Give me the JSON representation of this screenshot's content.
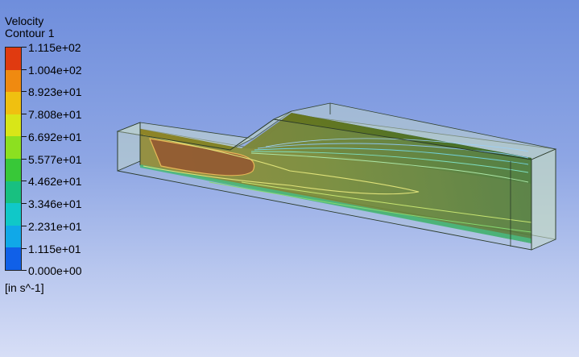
{
  "legend": {
    "title": "Velocity",
    "subtitle": "Contour 1",
    "units": "[in s^-1]",
    "levels": [
      {
        "label": "1.115e+02",
        "color": "#e03a10"
      },
      {
        "label": "1.004e+02",
        "color": "#f08a10"
      },
      {
        "label": "8.923e+01",
        "color": "#f0c010"
      },
      {
        "label": "7.808e+01",
        "color": "#d8e618"
      },
      {
        "label": "6.692e+01",
        "color": "#8ce020"
      },
      {
        "label": "5.577e+01",
        "color": "#38c838"
      },
      {
        "label": "4.462e+01",
        "color": "#18c080"
      },
      {
        "label": "3.346e+01",
        "color": "#10c8c8"
      },
      {
        "label": "2.231e+01",
        "color": "#10a8e8"
      },
      {
        "label": "1.115e+01",
        "color": "#1060e8"
      },
      {
        "label": "0.000e+00",
        "color": "#1030d0"
      }
    ]
  },
  "scene": {
    "background_top": "#6f8edc",
    "background_bottom": "#d7def6",
    "domain_fill": "#a8c8b0",
    "contour_line_color": "#e8e870"
  }
}
